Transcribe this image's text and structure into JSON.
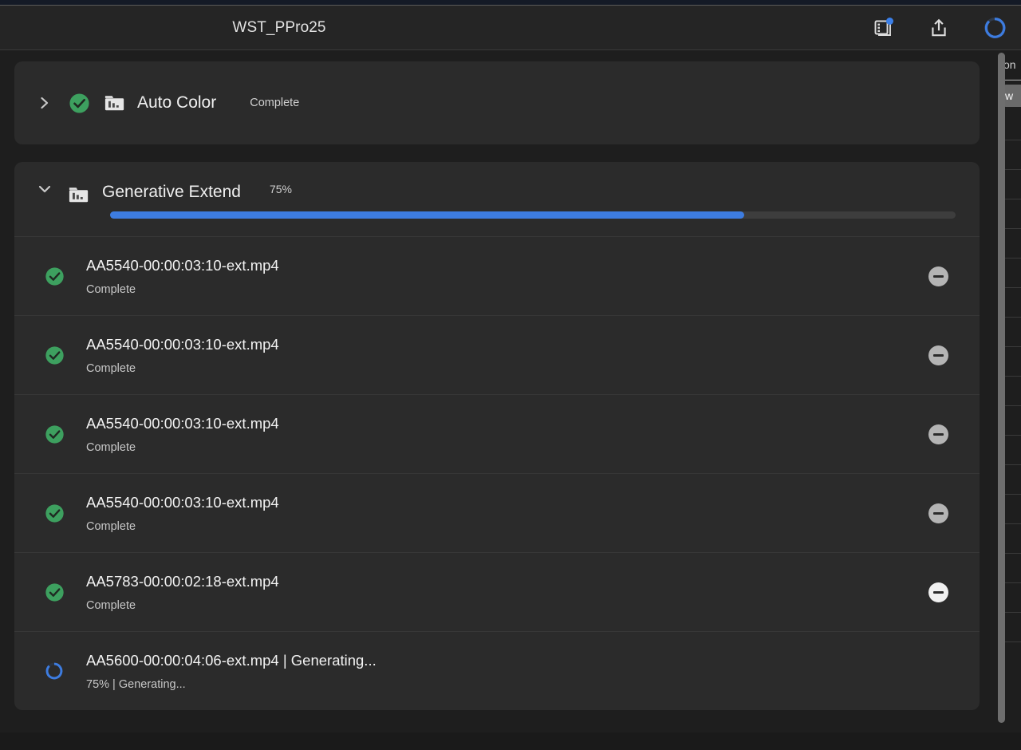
{
  "titlebar": {
    "title": "WST_PPro25",
    "icons": [
      {
        "name": "notifications-panel-icon",
        "label": "Notifications"
      },
      {
        "name": "share-export-icon",
        "label": "Share"
      },
      {
        "name": "progress-spinner-icon",
        "label": "Working"
      }
    ]
  },
  "sections": [
    {
      "id": "auto-color",
      "title": "Auto Color",
      "status": "Complete",
      "state": "complete",
      "expanded": false,
      "chevron": "chevron-right",
      "type_icon": "folder-chart-icon",
      "jobs": []
    },
    {
      "id": "generative-extend",
      "title": "Generative Extend",
      "status": "75%",
      "state": "in-progress",
      "expanded": true,
      "chevron": "chevron-down",
      "type_icon": "folder-chart-icon",
      "progress_percent": 75,
      "jobs": [
        {
          "name": "AA5540-00:00:03:10-ext.mp4",
          "sub": "Complete",
          "state": "complete",
          "remove_label": "Remove",
          "remove_hover": false
        },
        {
          "name": "AA5540-00:00:03:10-ext.mp4",
          "sub": "Complete",
          "state": "complete",
          "remove_label": "Remove",
          "remove_hover": false
        },
        {
          "name": "AA5540-00:00:03:10-ext.mp4",
          "sub": "Complete",
          "state": "complete",
          "remove_label": "Remove",
          "remove_hover": false
        },
        {
          "name": "AA5540-00:00:03:10-ext.mp4",
          "sub": "Complete",
          "state": "complete",
          "remove_label": "Remove",
          "remove_hover": false
        },
        {
          "name": "AA5783-00:00:02:18-ext.mp4",
          "sub": "Complete",
          "state": "complete",
          "remove_label": "Remove",
          "remove_hover": true
        },
        {
          "name": "AA5600-00:00:04:06-ext.mp4 | Generating...",
          "sub": "75% | Generating...",
          "state": "generating",
          "remove_label": "",
          "remove_hover": false
        }
      ]
    }
  ],
  "right_peek": {
    "fragments": [
      "on",
      "w"
    ]
  },
  "colors": {
    "accent_blue": "#3d7ce0",
    "success_green": "#3da05f",
    "page_bg": "#1e1e1e",
    "card_bg": "#2b2b2b",
    "titlebar_bg": "#252525"
  }
}
